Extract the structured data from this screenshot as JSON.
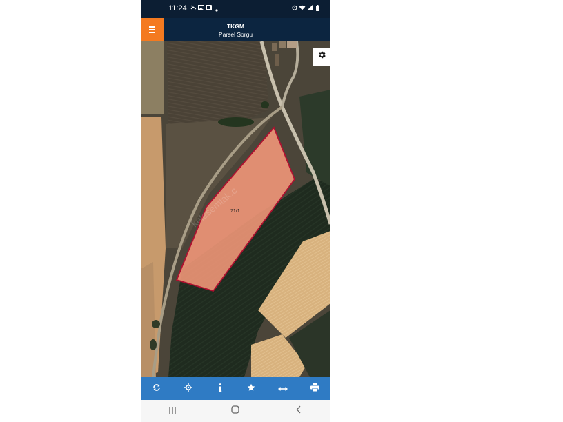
{
  "status_bar": {
    "time": "11:24",
    "left_icons": [
      "phone-missed-icon",
      "image-icon",
      "app-icon",
      "dot-icon"
    ],
    "right_icons": [
      "alarm-icon",
      "wifi-icon",
      "signal-icon",
      "battery-icon"
    ]
  },
  "header": {
    "title": "TKGM",
    "subtitle": "Parsel Sorgu",
    "menu_icon": "hamburger-icon",
    "accent_color": "#f47a20",
    "bar_color": "#0c2540"
  },
  "map": {
    "parcel_label": "71/1",
    "watermark": "kelesemlak.c",
    "settings_icon": "gear-icon",
    "parcel_fill": "#f5987a",
    "parcel_stroke": "#b01030"
  },
  "toolbar": {
    "color": "#2f7bc4",
    "buttons": [
      {
        "icon": "refresh-icon"
      },
      {
        "icon": "locate-icon"
      },
      {
        "icon": "info-icon"
      },
      {
        "icon": "star-icon"
      },
      {
        "icon": "measure-icon"
      },
      {
        "icon": "print-icon"
      }
    ]
  },
  "nav_bar": {
    "buttons": [
      "recent-apps-icon",
      "home-icon",
      "back-icon"
    ]
  }
}
